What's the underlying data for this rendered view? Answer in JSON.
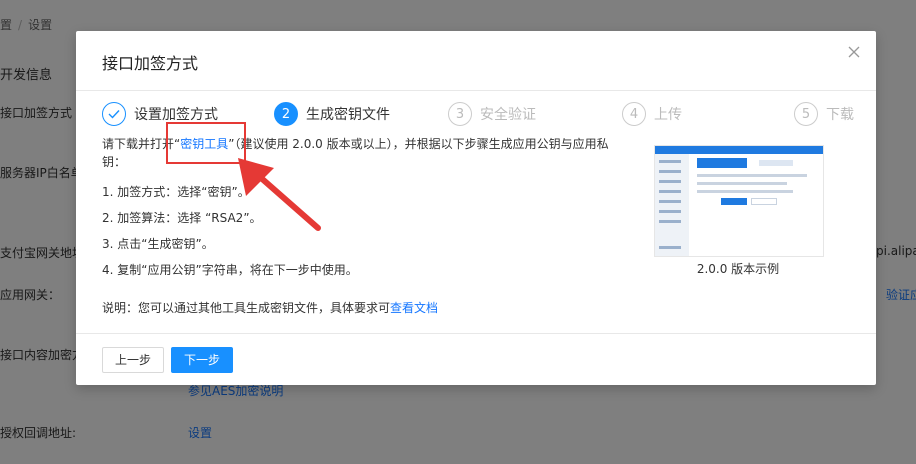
{
  "background": {
    "breadcrumb": {
      "prev": "置",
      "sep": "/",
      "current": "设置"
    },
    "section_title": "开发信息",
    "labels": [
      "接口加签方式",
      "服务器IP白名单",
      "支付宝网关地址",
      "应用网关：",
      "接口内容加密方",
      "授权回调地址:"
    ],
    "gateway_value": "pi.alipay.",
    "verify_link": "验证应",
    "aes_link": "参见AES加密说明",
    "settings_link": "设置"
  },
  "modal": {
    "title": "接口加签方式",
    "close_icon": "close-icon",
    "steps": [
      {
        "num": "✓",
        "label": "设置加签方式",
        "state": "done"
      },
      {
        "num": "2",
        "label": "生成密钥文件",
        "state": "active"
      },
      {
        "num": "3",
        "label": "安全验证",
        "state": "pending"
      },
      {
        "num": "4",
        "label": "上传",
        "state": "pending"
      },
      {
        "num": "5",
        "label": "下载",
        "state": "pending"
      }
    ],
    "intro_prefix": "请下载并打开“",
    "intro_link": "密钥工具",
    "intro_suffix": "”（建议使用 2.0.0 版本或以上），并根据以下步骤生成应用公钥与应用私钥：",
    "instructions": [
      "1. 加签方式：选择“密钥”。",
      "2. 加签算法：选择 “RSA2”。",
      "3. 点击“生成密钥”。",
      "4. 复制“应用公钥”字符串，将在下一步中使用。"
    ],
    "note_prefix": "说明：您可以通过其他工具生成密钥文件，具体要求可",
    "note_link": "查看文档",
    "preview_caption": "2.0.0 版本示例",
    "prev_button": "上一步",
    "next_button": "下一步"
  },
  "colors": {
    "primary": "#1890ff",
    "highlight": "#e53935"
  }
}
